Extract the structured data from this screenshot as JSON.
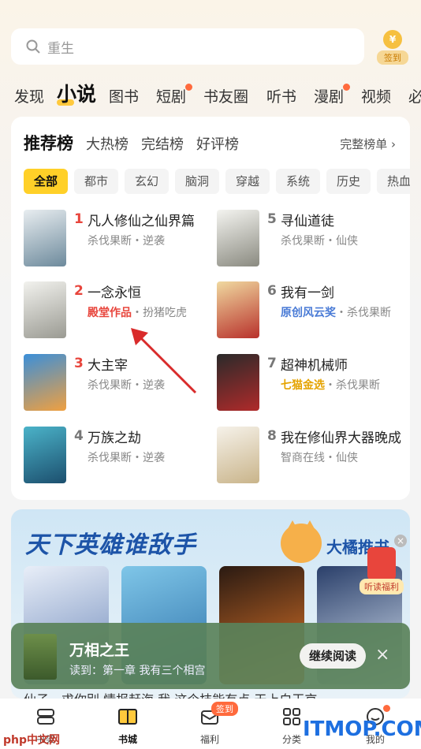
{
  "search": {
    "placeholder": "重生"
  },
  "signin": {
    "label": "签到",
    "coin": "¥"
  },
  "tabs": [
    "发现",
    "小说",
    "图书",
    "短剧",
    "书友圈",
    "听书",
    "漫剧",
    "视频",
    "必"
  ],
  "rank_tabs": [
    "推荐榜",
    "大热榜",
    "完结榜",
    "好评榜"
  ],
  "full_list": "完整榜单 ›",
  "chips": [
    "全部",
    "都市",
    "玄幻",
    "脑洞",
    "穿越",
    "系统",
    "历史",
    "热血"
  ],
  "books": [
    {
      "rank": "1",
      "title": "凡人修仙之仙界篇",
      "sub": "杀伐果断・逆袭",
      "tag": ""
    },
    {
      "rank": "2",
      "title": "一念永恒",
      "sub": "・扮猪吃虎",
      "tag": "殿堂作品"
    },
    {
      "rank": "3",
      "title": "大主宰",
      "sub": "杀伐果断・逆袭",
      "tag": ""
    },
    {
      "rank": "4",
      "title": "万族之劫",
      "sub": "杀伐果断・逆袭",
      "tag": ""
    },
    {
      "rank": "5",
      "title": "寻仙道徒",
      "sub": "杀伐果断・仙侠",
      "tag": ""
    },
    {
      "rank": "6",
      "title": "我有一剑",
      "sub": "・杀伐果断",
      "tag": "原创风云奖"
    },
    {
      "rank": "7",
      "title": "超神机械师",
      "sub": "・杀伐果断",
      "tag": "七猫金选"
    },
    {
      "rank": "8",
      "title": "我在修仙界大器晚成",
      "sub": "智商在线・仙侠",
      "tag": ""
    }
  ],
  "banner": {
    "title": "天下英雄谁敌手",
    "right": "大橘推书",
    "redpack": "听读福利",
    "close": "×"
  },
  "continue": {
    "title": "万相之王",
    "sub": "读到：第一章 我有三个相宫",
    "button": "继续阅读",
    "close": "×"
  },
  "peek": "仙子，求你别    情报赶海    我    这个技能有点    天上白玉京",
  "nav": [
    "书架",
    "书城",
    "福利",
    "分类",
    "我的"
  ],
  "nav_badge": "签到",
  "watermarks": {
    "left": "php中文网",
    "right": "ITMOP.COM"
  }
}
